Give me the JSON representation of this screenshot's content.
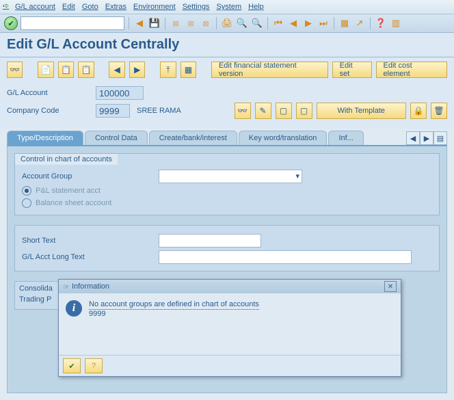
{
  "menu": [
    "G/L account",
    "Edit",
    "Goto",
    "Extras",
    "Environment",
    "Settings",
    "System",
    "Help"
  ],
  "page_title": "Edit G/L Account Centrally",
  "sub_buttons": {
    "fin_stmt": "Edit financial statement version",
    "edit_set": "Edit set",
    "edit_cost": "Edit cost element"
  },
  "fields": {
    "gl_label": "G/L Account",
    "gl_value": "100000",
    "cc_label": "Company Code",
    "cc_value": "9999",
    "cc_text": "SREE RAMA",
    "with_template": "With Template"
  },
  "tabs": [
    "Type/Description",
    "Control Data",
    "Create/bank/interest",
    "Key word/translation",
    "Inf..."
  ],
  "group1": {
    "title": "Control in chart of accounts",
    "account_group": "Account Group",
    "pl_stmt": "P&L statement acct",
    "balance": "Balance sheet account"
  },
  "group2": {
    "short": "Short Text",
    "long": "G/L Acct Long Text"
  },
  "group3": {
    "consol": "Consolida",
    "trading": "Trading P"
  },
  "popup": {
    "title": "Information",
    "msg1": "No account groups are defined in chart of accounts",
    "msg2": "9999"
  }
}
